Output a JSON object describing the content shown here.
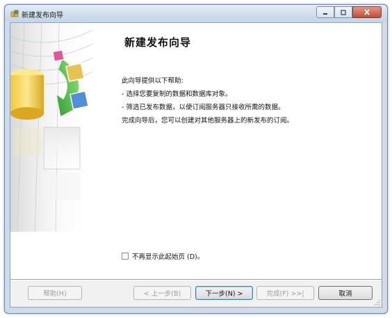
{
  "window": {
    "title": "新建发布向导",
    "controls": [
      "minimize-icon",
      "maximize-icon",
      "close-icon"
    ]
  },
  "page": {
    "heading": "新建发布向导",
    "intro": "此向导提供以下帮助:",
    "bullets": [
      "- 选择您要复制的数据和数据库对象。",
      "- 筛选已发布数据，以便订阅服务器只接收所需的数据。"
    ],
    "summary": "完成向导后，您可以创建对其他服务器上的新发布的订阅。",
    "checkbox_label": "不再显示此起始页 (D)。",
    "checkbox_checked": false
  },
  "buttons": {
    "help": "帮助(H)",
    "back": "< 上一步(B)",
    "next": "下一步(N) >",
    "finish": "完成(F) >>|",
    "cancel": "取消"
  }
}
